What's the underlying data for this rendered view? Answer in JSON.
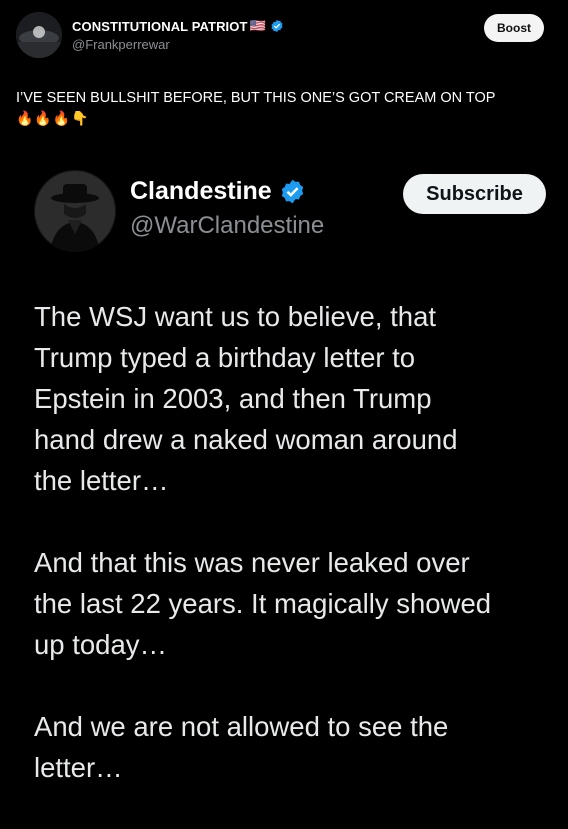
{
  "outer_post": {
    "author_name": "CONSTITUTIONAL PATRIOT",
    "author_flag": "🇺🇸",
    "author_handle": "@Frankperrewar",
    "boost_label": "Boost",
    "text": "I’VE SEEN BULLSHIT BEFORE, BUT THIS ONE’S GOT CREAM ON TOP",
    "emojis": "🔥🔥🔥👇"
  },
  "embedded_tweet": {
    "author_name": "Clandestine",
    "author_handle": "@WarClandestine",
    "subscribe_label": "Subscribe",
    "paragraphs": [
      "The WSJ want us to believe, that\nTrump typed a birthday letter to\nEpstein in 2003, and then Trump\nhand drew a naked woman around\nthe letter…",
      "And that this was never leaked over\nthe last 22 years. It magically showed\nup today…",
      "And we are not allowed to see the\nletter…"
    ]
  },
  "colors": {
    "background": "#000000",
    "verified_blue": "#1d9bf0",
    "muted_text": "#8b8f94"
  }
}
